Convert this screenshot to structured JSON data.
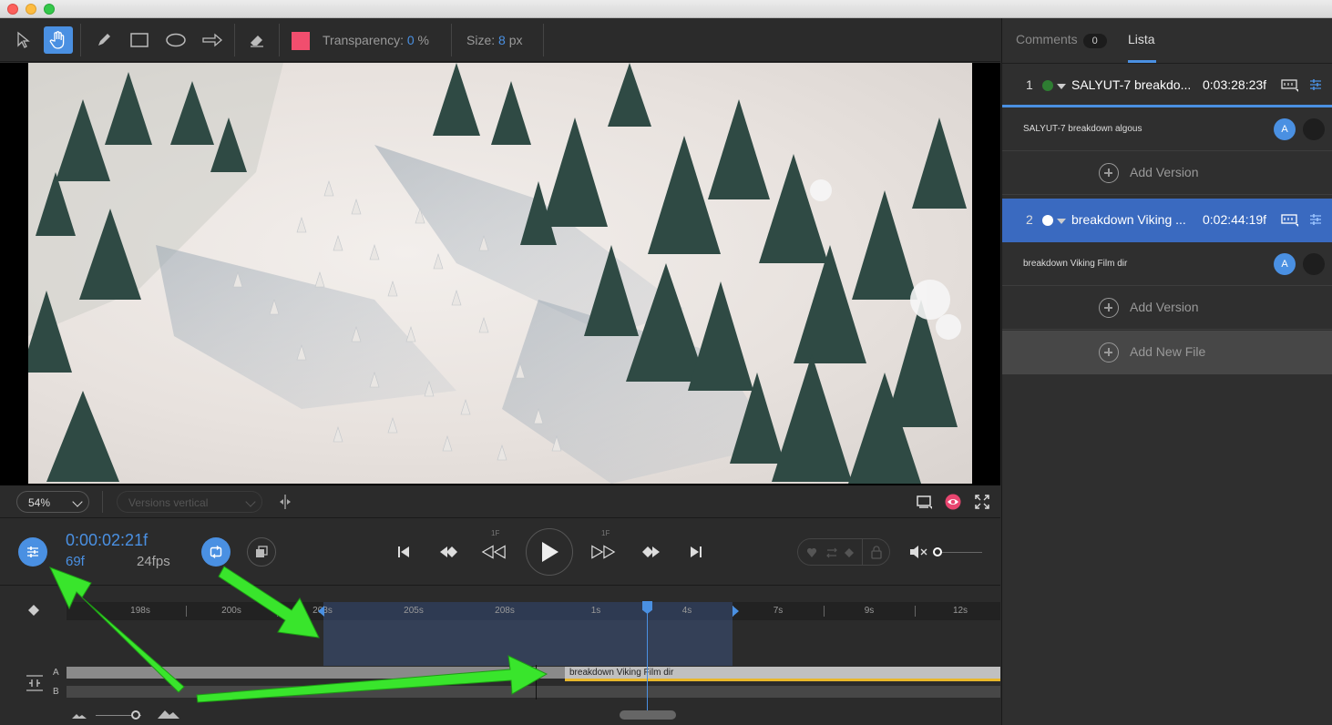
{
  "toolbar": {
    "tools": [
      "pointer-icon",
      "hand-icon",
      "pen-icon",
      "rectangle-icon",
      "ellipse-icon",
      "arrow-icon",
      "eraser-icon"
    ],
    "active_tool": "hand-icon",
    "color": "#f14e6e",
    "transparency_label": "Transparency:",
    "transparency_value": "0",
    "transparency_unit": "%",
    "size_label": "Size:",
    "size_value": "8",
    "size_unit": "px"
  },
  "viewbar": {
    "zoom": "54%",
    "versions_layout": "Versions vertical"
  },
  "playback": {
    "timecode": "0:00:02:21f",
    "frames": "69f",
    "fps": "24fps",
    "step_back_label": "1F",
    "step_fwd_label": "1F"
  },
  "timeline": {
    "ruler_labels": [
      "198s",
      "200s",
      "203s",
      "205s",
      "208s",
      "1s",
      "4s",
      "7s",
      "9s",
      "12s"
    ],
    "track_a_label": "A",
    "track_b_label": "B",
    "clip_label": "breakdown Viking Film dir"
  },
  "sidepanel": {
    "tab_comments": "Comments",
    "comments_count": "0",
    "tab_lista": "Lista",
    "files": [
      {
        "index": "1",
        "name": "SALYUT-7 breakdo...",
        "duration": "0:03:28:23f",
        "version": "SALYUT-7 breakdown algous",
        "avatar": "A",
        "dot_color": "#2e7d32"
      },
      {
        "index": "2",
        "name": "breakdown Viking ...",
        "duration": "0:02:44:19f",
        "version": "breakdown Viking Film dir",
        "avatar": "A",
        "dot_color": "#ffffff"
      }
    ],
    "add_version": "Add Version",
    "add_new_file": "Add New File"
  },
  "colors": {
    "accent": "#4a90e2",
    "annotation": "#39e52c",
    "clip_marker": "#e8b72a"
  }
}
